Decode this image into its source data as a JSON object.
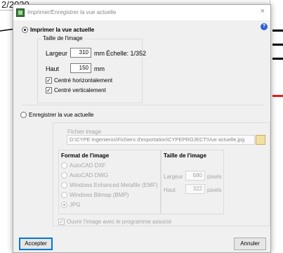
{
  "background": {
    "date": "2/2020"
  },
  "dialog": {
    "title": "Imprimer/Enregistrer la vue actuelle",
    "close": "×",
    "help": "?",
    "print": {
      "label": "Imprimer la vue actuelle",
      "selected": true,
      "size_group": "Taille de l'image",
      "width_label": "Largeur",
      "width_value": "310",
      "width_unit": "mm",
      "scale_label": "Échelle: 1/352",
      "height_label": "Haut",
      "height_value": "150",
      "height_unit": "mm",
      "center_h": "Centré horizontalement",
      "center_h_checked": true,
      "center_v": "Centré verticalement",
      "center_v_checked": true
    },
    "save": {
      "label": "Enregistrer la vue actuelle",
      "selected": false,
      "file_label": "Fichier image",
      "file_path": "D:\\CYPE Ingenieros\\Fichiers d'exportation\\CYPEPROJECT\\Vue actuelle.jpg",
      "format_title": "Format de l'image",
      "formats": [
        {
          "label": "AutoCAD DXF",
          "selected": false
        },
        {
          "label": "AutoCAD DWG",
          "selected": false
        },
        {
          "label": "Windows Enhanced Metafile (EMF)",
          "selected": false
        },
        {
          "label": "Windows Bitmap (BMP)",
          "selected": false
        },
        {
          "label": "JPG",
          "selected": true
        }
      ],
      "size_title": "Taille de l'image",
      "width_label": "Largeur",
      "width_value": "680",
      "width_unit": "pixels",
      "height_label": "Haut",
      "height_value": "322",
      "height_unit": "pixels",
      "open_label": "Ouvrir l'image avec le programme associé",
      "open_checked": true
    },
    "buttons": {
      "accept": "Accepter",
      "cancel": "Annuler"
    }
  },
  "colors": {
    "accent": "#0078d7",
    "background_bar_red": "#e02020"
  }
}
